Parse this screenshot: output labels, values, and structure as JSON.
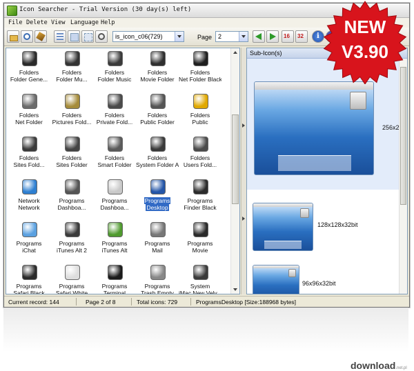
{
  "window": {
    "title": "Icon Searcher - Trial Version (30 day(s) left)",
    "menu": [
      "File",
      "Delete",
      "View",
      "Language",
      "Help"
    ]
  },
  "toolbar": {
    "library_combo_value": "is_icon_c06(729)",
    "page_label": "Page",
    "page_value": "2",
    "btn16_label": "16",
    "btn32_label": "32",
    "info_label": "i"
  },
  "icon_grid": [
    [
      {
        "line1": "Folders",
        "line2": "Folder Gene...",
        "icon": "folder-generic-icon",
        "color": "#2a2a2a"
      },
      {
        "line1": "Folders",
        "line2": "Folder Mu...",
        "icon": "folder-music-icon",
        "color": "#333333"
      },
      {
        "line1": "Folders",
        "line2": "Folder Music",
        "icon": "folder-music-icon",
        "color": "#3a3a3a"
      },
      {
        "line1": "Folders",
        "line2": "Movie Folder",
        "icon": "movie-folder-icon",
        "color": "#2f2f2f"
      },
      {
        "line1": "Folders",
        "line2": "Net Folder Black",
        "icon": "net-folder-icon",
        "color": "#1e1e1e"
      }
    ],
    [
      {
        "line1": "Folders",
        "line2": "Net Folder",
        "icon": "net-folder-icon",
        "color": "#6b6b6b"
      },
      {
        "line1": "Folders",
        "line2": "Pictures Fold...",
        "icon": "pictures-folder-icon",
        "color": "#a58b3a"
      },
      {
        "line1": "Folders",
        "line2": "Private Fold...",
        "icon": "private-folder-icon",
        "color": "#4a4a4a"
      },
      {
        "line1": "Folders",
        "line2": "Public Folder",
        "icon": "public-folder-icon",
        "color": "#555555"
      },
      {
        "line1": "Folders",
        "line2": "Public",
        "icon": "public-sign-icon",
        "color": "#e0a800"
      }
    ],
    [
      {
        "line1": "Folders",
        "line2": "Sites Fold...",
        "icon": "sites-folder-icon",
        "color": "#3b3b3b"
      },
      {
        "line1": "Folders",
        "line2": "Sites Folder",
        "icon": "sites-folder-icon",
        "color": "#444444"
      },
      {
        "line1": "Folders",
        "line2": "Smart Folder",
        "icon": "smart-folder-icon",
        "color": "#5a5a5a"
      },
      {
        "line1": "Folders",
        "line2": "System Folder Alt",
        "icon": "system-folder-icon",
        "color": "#3a3a3a"
      },
      {
        "line1": "Folders",
        "line2": "Users Fold...",
        "icon": "users-folder-icon",
        "color": "#4b4b4b"
      }
    ],
    [
      {
        "line1": "Network",
        "line2": "Network",
        "icon": "network-globe-icon",
        "color": "#2e7fd1"
      },
      {
        "line1": "Programs",
        "line2": "Dashboa...",
        "icon": "dashboard-icon",
        "color": "#555555"
      },
      {
        "line1": "Programs",
        "line2": "Dashboa...",
        "icon": "dashboard-icon",
        "color": "#c9c9c9"
      },
      {
        "line1": "Programs",
        "line2": "Desktop",
        "icon": "desktop-icon",
        "color": "#2456a8"
      },
      {
        "line1": "Programs",
        "line2": "Finder Black",
        "icon": "finder-icon",
        "color": "#2b2b2b"
      }
    ],
    [
      {
        "line1": "Programs",
        "line2": "iChat",
        "icon": "ichat-icon",
        "color": "#5aa0e0"
      },
      {
        "line1": "Programs",
        "line2": "iTunes Alt 2",
        "icon": "itunes-icon",
        "color": "#3a3a3a"
      },
      {
        "line1": "Programs",
        "line2": "iTunes Alt",
        "icon": "itunes-icon",
        "color": "#4f9a2e"
      },
      {
        "line1": "Programs",
        "line2": "Mail",
        "icon": "mail-icon",
        "color": "#777777"
      },
      {
        "line1": "Programs",
        "line2": "Movie",
        "icon": "movie-clapper-icon",
        "color": "#2a2a2a"
      }
    ],
    [
      {
        "line1": "Programs",
        "line2": "Safari Black",
        "icon": "safari-icon",
        "color": "#2a2a2a"
      },
      {
        "line1": "Programs",
        "line2": "Safari White",
        "icon": "safari-icon",
        "color": "#dddddd"
      },
      {
        "line1": "Programs",
        "line2": "Terminal",
        "icon": "terminal-icon",
        "color": "#1a1a1a"
      },
      {
        "line1": "Programs",
        "line2": "Trash Empty",
        "icon": "trash-icon",
        "color": "#888888"
      },
      {
        "line1": "System",
        "line2": "iMac New Velv...",
        "icon": "imac-icon",
        "color": "#3a3a3a"
      }
    ]
  ],
  "selected_cell": {
    "row": 3,
    "col": 3
  },
  "sub_icons": {
    "header": "Sub-Icon(s)",
    "sizes": [
      "256x256",
      "128x128x32bit",
      "96x96x32bit"
    ]
  },
  "status": {
    "current_record": "Current record: 144",
    "page": "Page 2 of 8",
    "total_icons": "Total icons: 729",
    "file_info": "ProgramsDesktop [Size:188968 bytes]"
  },
  "badge": {
    "line1": "NEW",
    "line2": "V3.90"
  },
  "watermark": {
    "brand": "download",
    "suffix": ".net.pl"
  },
  "colors": {
    "badge_red": "#d8141c",
    "selection_blue": "#316ac5",
    "accent_green": "#2e9a2a"
  }
}
